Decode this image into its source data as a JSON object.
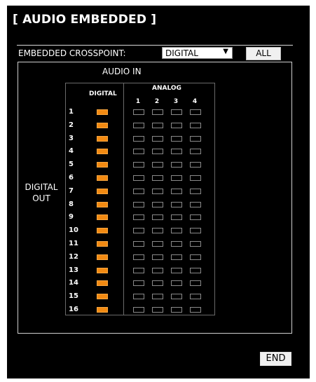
{
  "title": "[ AUDIO EMBEDDED ]",
  "crosspoint": {
    "label": "EMBEDDED CROSSPOINT:",
    "selected": "DIGITAL",
    "all_label": "ALL"
  },
  "audio_in_label": "AUDIO IN",
  "digital_out_label": "DIGITAL\nOUT",
  "headers": {
    "digital": "DIGITAL",
    "analog": "ANALOG",
    "analog_channels": [
      "1",
      "2",
      "3",
      "4"
    ]
  },
  "rows": [
    {
      "num": "1",
      "digital": true,
      "analog": [
        false,
        false,
        false,
        false
      ]
    },
    {
      "num": "2",
      "digital": true,
      "analog": [
        false,
        false,
        false,
        false
      ]
    },
    {
      "num": "3",
      "digital": true,
      "analog": [
        false,
        false,
        false,
        false
      ]
    },
    {
      "num": "4",
      "digital": true,
      "analog": [
        false,
        false,
        false,
        false
      ]
    },
    {
      "num": "5",
      "digital": true,
      "analog": [
        false,
        false,
        false,
        false
      ]
    },
    {
      "num": "6",
      "digital": true,
      "analog": [
        false,
        false,
        false,
        false
      ]
    },
    {
      "num": "7",
      "digital": true,
      "analog": [
        false,
        false,
        false,
        false
      ]
    },
    {
      "num": "8",
      "digital": true,
      "analog": [
        false,
        false,
        false,
        false
      ]
    },
    {
      "num": "9",
      "digital": true,
      "analog": [
        false,
        false,
        false,
        false
      ]
    },
    {
      "num": "10",
      "digital": true,
      "analog": [
        false,
        false,
        false,
        false
      ]
    },
    {
      "num": "11",
      "digital": true,
      "analog": [
        false,
        false,
        false,
        false
      ]
    },
    {
      "num": "12",
      "digital": true,
      "analog": [
        false,
        false,
        false,
        false
      ]
    },
    {
      "num": "13",
      "digital": true,
      "analog": [
        false,
        false,
        false,
        false
      ]
    },
    {
      "num": "14",
      "digital": true,
      "analog": [
        false,
        false,
        false,
        false
      ]
    },
    {
      "num": "15",
      "digital": true,
      "analog": [
        false,
        false,
        false,
        false
      ]
    },
    {
      "num": "16",
      "digital": true,
      "analog": [
        false,
        false,
        false,
        false
      ]
    }
  ],
  "end_label": "END",
  "colors": {
    "background": "#000000",
    "active": "#f28a12",
    "inactive_border": "#8a8a8a"
  }
}
